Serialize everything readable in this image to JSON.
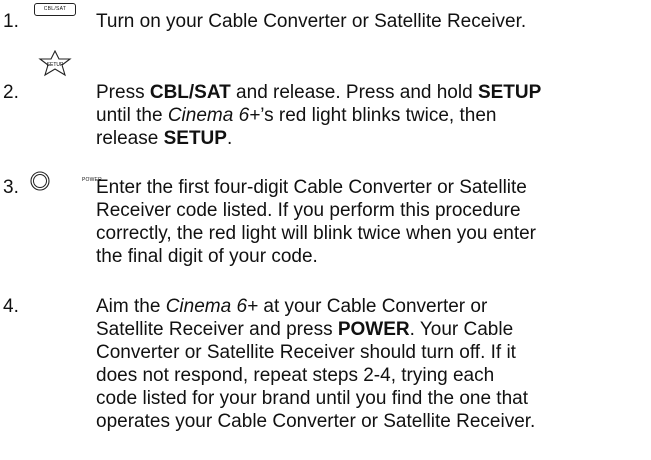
{
  "steps": [
    {
      "number": "1.",
      "icon": "cbl-sat-button-icon",
      "icon_label": "CBL/SAT"
    },
    {
      "number": "2.",
      "icon": "setup-star-button-icon",
      "icon_label": "SETUP"
    },
    {
      "number": "3.",
      "icon": "power-button-icon",
      "icon_label": "POWER"
    },
    {
      "number": "4."
    }
  ],
  "s1": {
    "line": "Turn on your Cable Converter or Satellite Receiver."
  },
  "s2": {
    "a": "Press ",
    "b": "CBL/SAT",
    "c": " and release. Press and hold ",
    "d": "SETUP",
    "e": "until the ",
    "f": "Cinema 6+",
    "g": "’s red light blinks twice, then",
    "h": "release ",
    "i": "SETUP",
    "j": "."
  },
  "s3": {
    "l1": "Enter the first four-digit Cable Converter or Satellite",
    "l2": "Receiver code listed. If you perform this procedure",
    "l3": "correctly, the red light will blink twice when you enter",
    "l4": "the final digit of your code."
  },
  "s4": {
    "a": "Aim the ",
    "b": "Cinema 6+",
    "c": " at your Cable Converter or",
    "d": "Satellite Receiver and press ",
    "e": "POWER",
    "f": ". Your Cable",
    "l3": "Converter or Satellite Receiver should turn off. If it",
    "l4": "does not respond, repeat steps 2-4, trying each",
    "l5": "code listed for your brand until you find the one that",
    "l6": "operates your Cable Converter or Satellite Receiver."
  }
}
